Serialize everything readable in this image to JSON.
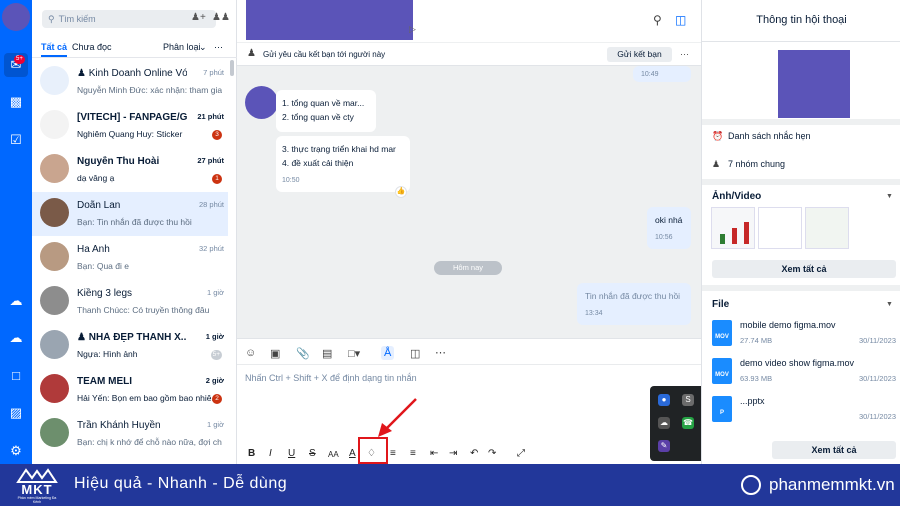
{
  "sidebar": {
    "notification_count": "5+",
    "search_placeholder": "Tìm kiếm",
    "tabs": {
      "all": "Tất cả",
      "unread": "Chưa đọc",
      "classify": "Phân loại"
    },
    "conversations": [
      {
        "name": "Kinh Doanh Online Với ...",
        "preview": "Nguyễn Minh Đức: xác nhận: tham gia ...",
        "time": "7 phút",
        "unread": "",
        "bold": false,
        "group": true,
        "avatar_color": "#e8f0fb"
      },
      {
        "name": "[VITECH] - FANPAGE/GRO...",
        "preview": "Nghiêm Quang Huy: Sticker",
        "time": "21 phút",
        "unread": "3",
        "bold": true,
        "group": false,
        "avatar_color": "#f3f3f3"
      },
      {
        "name": "Nguyễn Thu Hoài",
        "preview": "dạ vâng ạ",
        "time": "27 phút",
        "unread": "1",
        "bold": true,
        "group": false,
        "avatar_color": "#c9a58f"
      },
      {
        "name": "Doãn Lan",
        "preview": "Bạn: Tin nhắn đã được thu hồi",
        "time": "28 phút",
        "unread": "",
        "bold": false,
        "group": false,
        "avatar_color": "#7a5a48"
      },
      {
        "name": "Ha Anh",
        "preview": "Bạn: Qua đi e",
        "time": "32 phút",
        "unread": "",
        "bold": false,
        "group": false,
        "avatar_color": "#b89a82"
      },
      {
        "name": "Kiềng 3 legs",
        "preview": "Thanh Chúcc: Có truyền thông đâu",
        "time": "1 giờ",
        "unread": "",
        "bold": false,
        "group": false,
        "avatar_color": "#8d8d8d"
      },
      {
        "name": "NHÀ ĐẸP THANH X...",
        "preview": "Ngựa: Hình ảnh",
        "time": "1 giờ",
        "unread": "5+",
        "bold": true,
        "group": true,
        "avatar_color": "#9aa5b1"
      },
      {
        "name": "TEAM MELI",
        "preview": "Hải Yến: Bọn em bao gồm bao nhiê...",
        "time": "2 giờ",
        "unread": "2",
        "bold": true,
        "group": false,
        "avatar_color": "#b03a3a"
      },
      {
        "name": "Trần Khánh Huyền",
        "preview": "Bạn: chị k nhớ để chỗ nào nữa, đợi chị...",
        "time": "1 giờ",
        "unread": "",
        "bold": false,
        "group": false,
        "avatar_color": "#6d8f6d"
      }
    ]
  },
  "chat": {
    "friend_request_text": "Gửi yêu cầu kết bạn tới người này",
    "friend_request_button": "Gửi kết bạn",
    "top_time": "10:49",
    "msg1_line1": "1. tổng quan về mar...",
    "msg1_line2": "2. tổng quan về cty",
    "msg2_line1": "3. thực trạng triển khai hd mar",
    "msg2_line2": "4. đề xuất cải thiện",
    "msg2_time": "10:50",
    "msg3_text": "oki nhá",
    "msg3_time": "10:56",
    "date_pill": "Hôm nay",
    "msg4_text": "Tin nhắn đã được thu hồi",
    "msg4_time": "13:34",
    "composer_placeholder": "Nhấn Ctrl + Shift + X để định dạng tin nhắn"
  },
  "info": {
    "title": "Thông tin hội thoại",
    "reminders": "Danh sách nhắc hẹn",
    "common_groups": "7 nhóm chung",
    "media_section": "Ảnh/Video",
    "see_all": "Xem tất cả",
    "file_section": "File",
    "files": [
      {
        "name": "mobile demo figma.mov",
        "size": "27.74 MB",
        "date": "30/11/2023",
        "ext": "MOV"
      },
      {
        "name": "demo video show figma.mov",
        "size": "63.93 MB",
        "date": "30/11/2023",
        "ext": "MOV"
      },
      {
        "name": "...pptx",
        "size": "",
        "date": "30/11/2023",
        "ext": "P"
      }
    ]
  },
  "banner": {
    "logo": "MKT",
    "logo_sub": "Phần mềm Marketing Đa Kênh",
    "slogan": "Hiệu quả - Nhanh - Dễ dùng",
    "site": "phanmemmkt.vn"
  },
  "colors": {
    "brand": "#0068ff",
    "banner": "#22379a",
    "highlight": "#e0161b"
  }
}
